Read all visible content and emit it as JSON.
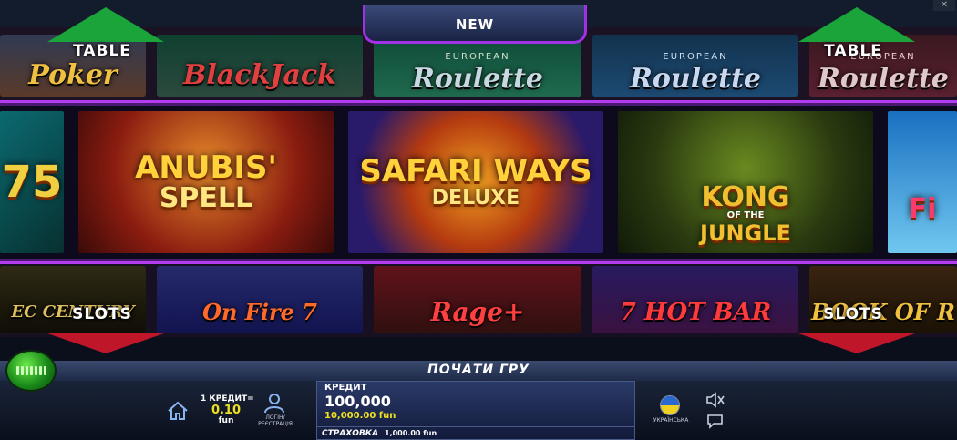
{
  "header": {
    "new_label": "NEW"
  },
  "sections": {
    "table_left": "TABLE",
    "table_right": "TABLE",
    "slots_left": "SLOTS",
    "slots_right": "SLOTS"
  },
  "top_row": [
    {
      "name": "Poker",
      "id": "poker"
    },
    {
      "name": "BlackJack",
      "id": "blackjack"
    },
    {
      "name": "Roulette",
      "sup": "EUROPEAN",
      "id": "euro1"
    },
    {
      "name": "Roulette",
      "sup": "EUROPEAN",
      "id": "euro2"
    },
    {
      "name": "Roulette",
      "sup": "EUROPEAN",
      "id": "euro3"
    }
  ],
  "featured": [
    {
      "title": "75"
    },
    {
      "title": "ANUBIS'",
      "subtitle": "SPELL"
    },
    {
      "title": "SAFARI WAYS",
      "subtitle": "DELUXE"
    },
    {
      "title": "KONG",
      "mid": "OF THE",
      "subtitle": "JUNGLE"
    },
    {
      "title": "Fi"
    }
  ],
  "bottom_row": [
    {
      "name": "EC CENTURY"
    },
    {
      "name": "On Fire 7"
    },
    {
      "name": "Rage+"
    },
    {
      "name": "7 HOT BAR"
    },
    {
      "name": "BOOK OF R"
    }
  ],
  "start_label": "ПОЧАТИ ГРУ",
  "denomination": {
    "label": "1 КРЕДИТ=",
    "value": "0.10",
    "unit": "fun"
  },
  "login_label": "ЛОГІН/ РЕЄСТРАЦІЯ",
  "credit": {
    "label": "КРЕДИТ",
    "value": "100,000",
    "fun_value": "10,000.00 fun"
  },
  "insurance": {
    "label": "СТРАХОВКА",
    "value": "1,000.00 fun"
  },
  "language_label": "УКРАЇНСЬКА",
  "colors": {
    "accent_purple": "#b43cf0",
    "up_arrow": "#1aa43a",
    "down_arrow": "#c0162a",
    "credit_yellow": "#f0e020"
  }
}
